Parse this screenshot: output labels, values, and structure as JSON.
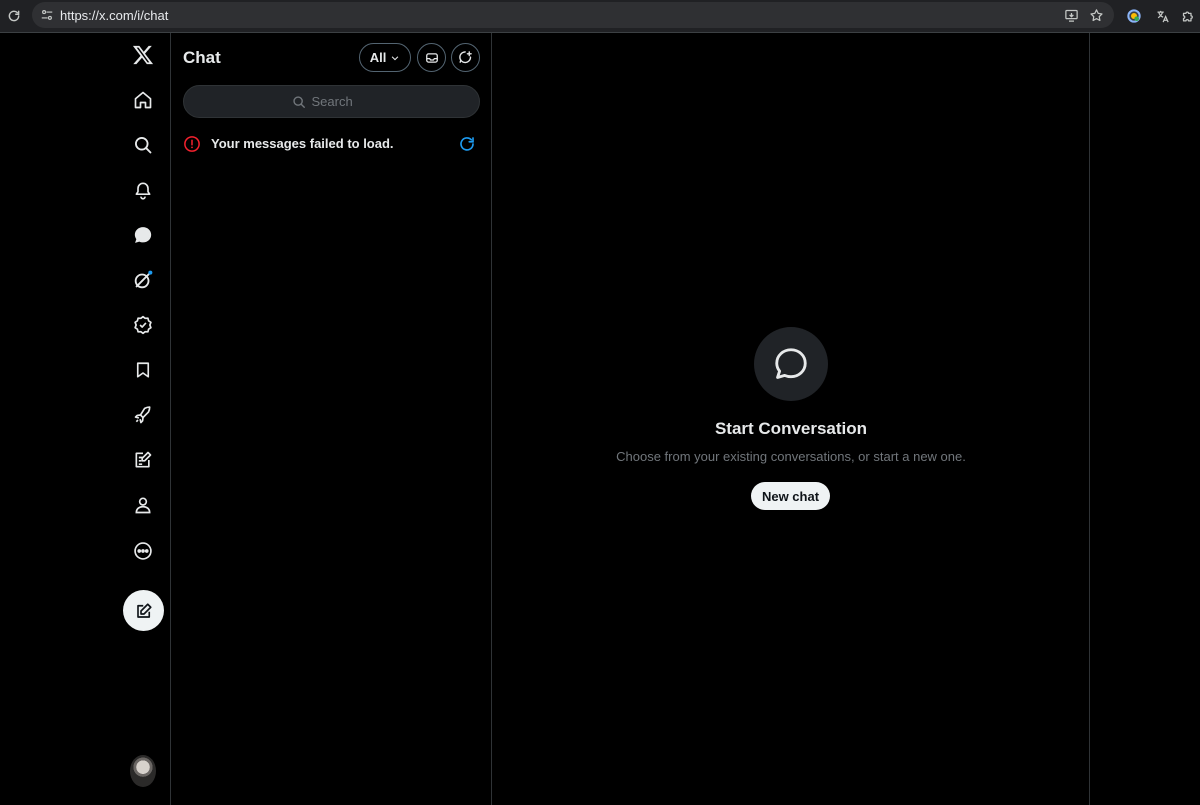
{
  "browser": {
    "url": "https://x.com/i/chat",
    "icons": [
      "reload-icon",
      "site-info-icon",
      "install-app-icon",
      "bookmark-star-icon",
      "profile-icon",
      "translate-extension-icon",
      "extensions-puzzle-icon"
    ]
  },
  "nav": {
    "logo": "x-logo",
    "items": [
      {
        "name": "home",
        "icon": "home-icon"
      },
      {
        "name": "explore",
        "icon": "search-icon"
      },
      {
        "name": "notifications",
        "icon": "bell-icon"
      },
      {
        "name": "chat",
        "icon": "chat-bubble-icon",
        "active": true
      },
      {
        "name": "grok",
        "icon": "grok-icon",
        "badge": true
      },
      {
        "name": "premium",
        "icon": "verified-badge-icon"
      },
      {
        "name": "bookmarks",
        "icon": "bookmark-icon"
      },
      {
        "name": "business",
        "icon": "rocket-icon"
      },
      {
        "name": "articles",
        "icon": "article-edit-icon"
      },
      {
        "name": "profile",
        "icon": "person-icon"
      },
      {
        "name": "more",
        "icon": "more-circle-icon"
      }
    ],
    "compose_icon": "compose-icon"
  },
  "chat_list": {
    "title": "Chat",
    "filter": "All",
    "search_placeholder": "Search",
    "error_message": "Your messages failed to load."
  },
  "main": {
    "title": "Start Conversation",
    "subtitle": "Choose from your existing conversations, or start a new one.",
    "new_chat_label": "New chat"
  },
  "colors": {
    "background": "#000000",
    "text": "#e7e9ea",
    "muted": "#71767b",
    "border": "#2f3336",
    "error": "#f4212e",
    "accent": "#1d9bf0"
  }
}
